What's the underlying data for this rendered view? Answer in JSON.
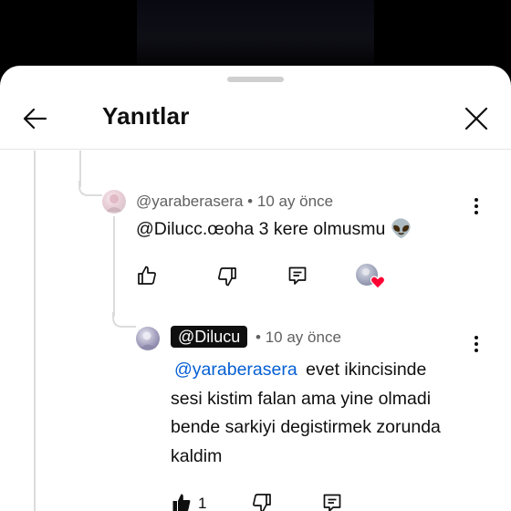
{
  "header": {
    "title": "Yanıtlar"
  },
  "replies": [
    {
      "handle": "@yaraberasera",
      "separator": "•",
      "time": "10 ay önce",
      "text": "@Dilucc.œoha 3 kere olmusmu",
      "emoji": "👽"
    },
    {
      "handle": "@Dilucu",
      "separator": "•",
      "time": "10 ay önce",
      "mention": "@yaraberasera",
      "text_lines": [
        "evet ikincisinde",
        "sesi kistim falan ama yine olmadi",
        "bende sarkiyi degistirmek zorunda",
        "kaldim"
      ],
      "like_count": "1"
    }
  ],
  "colors": {
    "mention": "#065fd4",
    "heart": "#ff0033",
    "chip_bg": "#0f0f0f"
  }
}
